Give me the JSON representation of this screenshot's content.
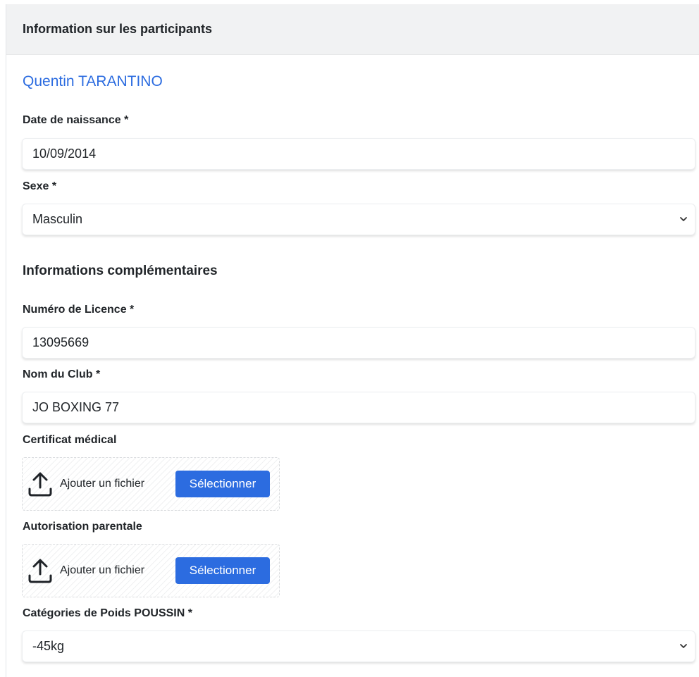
{
  "header": {
    "title": "Information sur les participants"
  },
  "participant": {
    "name": "Quentin TARANTINO"
  },
  "birthdate": {
    "label": "Date de naissance *",
    "value": "10/09/2014"
  },
  "sexe": {
    "label": "Sexe *",
    "value": "Masculin"
  },
  "complementary": {
    "title": "Informations complémentaires"
  },
  "licence": {
    "label": "Numéro de Licence *",
    "value": "13095669"
  },
  "club": {
    "label": "Nom du Club *",
    "value": "JO BOXING 77"
  },
  "certificat": {
    "label": "Certificat médical",
    "upload_text": "Ajouter un fichier",
    "button_label": "Sélectionner"
  },
  "autorisation": {
    "label": "Autorisation parentale",
    "upload_text": "Ajouter un fichier",
    "button_label": "Sélectionner"
  },
  "poids": {
    "label": "Catégories de Poids POUSSIN *",
    "value": "-45kg"
  },
  "colors": {
    "accent": "#2c6ce0",
    "header_bg": "#f1f2f3"
  },
  "icons": {
    "upload": "upload-icon",
    "chevron": "chevron-down-icon"
  }
}
